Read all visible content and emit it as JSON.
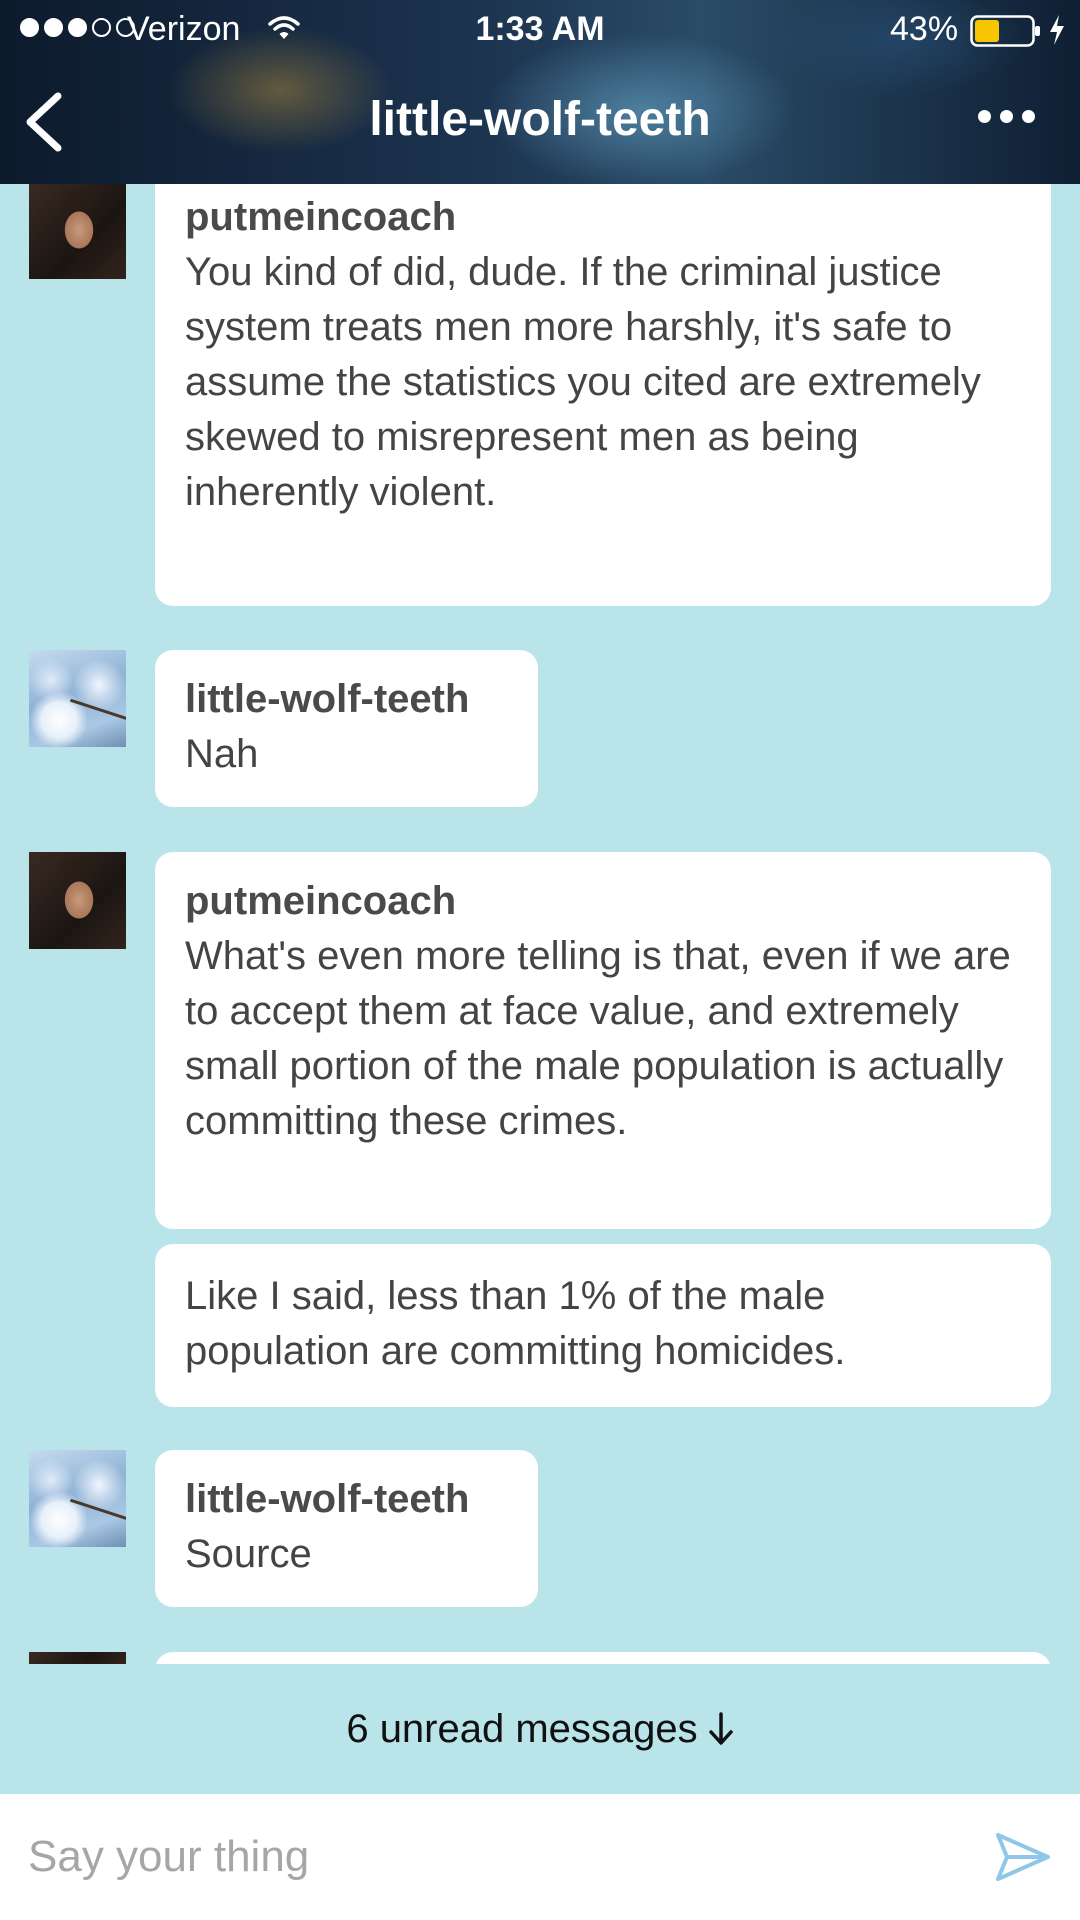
{
  "status_bar": {
    "carrier": "Verizon",
    "time": "1:33 AM",
    "battery": "43%",
    "signal_bars_filled": 3,
    "signal_bars_total": 5,
    "battery_level": 0.43
  },
  "nav": {
    "title": "little-wolf-teeth",
    "icons": [
      "back-chevron-icon",
      "more-dots-icon"
    ]
  },
  "messages": [
    {
      "sender": "putmeincoach",
      "avatar": "putmeincoach-avatar",
      "text": "You kind of did, dude. If the criminal justice system treats men more harshly, it's safe to assume the statistics you cited are extremely skewed to misrepresent men as being inherently violent."
    },
    {
      "sender": "little-wolf-teeth",
      "avatar": "little-wolf-teeth-avatar",
      "text": "Nah"
    },
    {
      "sender": "putmeincoach",
      "avatar": "putmeincoach-avatar",
      "text": "What's even more telling is that, even if we are to accept them at face value, and extremely small portion of the male population is actually committing these crimes."
    },
    {
      "sender": "",
      "avatar": "",
      "text": "Like I said, less than 1% of the male population are committing homicides."
    },
    {
      "sender": "little-wolf-teeth",
      "avatar": "little-wolf-teeth-avatar",
      "text": "Source"
    }
  ],
  "unread": {
    "label": "6 unread messages"
  },
  "composer": {
    "placeholder": "Say your thing",
    "value": ""
  },
  "colors": {
    "chat_background": "#b9e4ea",
    "bubble": "#ffffff",
    "battery_fill": "#f7c600",
    "send_accent": "#8ec7e8"
  }
}
